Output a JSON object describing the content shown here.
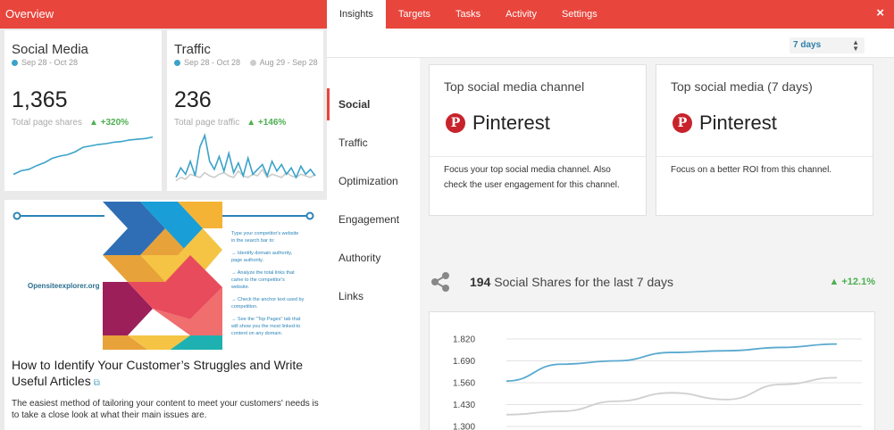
{
  "topbar": {
    "overview_title": "Overview",
    "tabs": [
      "Insights",
      "Targets",
      "Tasks",
      "Activity",
      "Settings"
    ],
    "close_glyph": "×"
  },
  "left": {
    "social": {
      "title": "Social Media",
      "range": "Sep 28 - Oct 28",
      "value": "1,365",
      "label": "Total page shares",
      "change": "▲ +320%",
      "color": "#3aa3c9",
      "spark": [
        3,
        8,
        10,
        15,
        19,
        25,
        28,
        30,
        34,
        40,
        42,
        44,
        45,
        47,
        48,
        50,
        51,
        52,
        54
      ]
    },
    "traffic": {
      "title": "Traffic",
      "range_a": "Sep 28 - Oct 28",
      "range_b": "Aug 29 - Sep 28",
      "value": "236",
      "label": "Total page traffic",
      "change": "▲ +146%",
      "color_a": "#3aa3c9",
      "color_b": "#cccccc",
      "spark_a": [
        10,
        22,
        14,
        30,
        12,
        48,
        62,
        30,
        20,
        36,
        18,
        40,
        16,
        28,
        12,
        34,
        14,
        20,
        26,
        12,
        30,
        18,
        26,
        14,
        22,
        10,
        24,
        14,
        20,
        12
      ],
      "spark_b": [
        6,
        10,
        8,
        14,
        12,
        10,
        16,
        12,
        10,
        14,
        16,
        12,
        10,
        18,
        12,
        10,
        14,
        12,
        20,
        10,
        14,
        12,
        10,
        16,
        12,
        10,
        14,
        12,
        10,
        14
      ]
    },
    "infographic": {
      "brand": "Opensiteexplorer.org",
      "tips": [
        "Type your competitor's website",
        "in the search bar to:",
        "→ Identify domain authority,",
        "page authority.",
        "→ Analyze the total links that",
        "came to the competitor's",
        "website.",
        "→ Check the anchor text used by",
        "competition.",
        "→ See the \"Top Pages\" tab that",
        "will show you the most linked-to",
        "content on any domain."
      ]
    },
    "article": {
      "title": "How to Identify Your Customer’s Struggles and Write Useful Articles",
      "link_glyph": "⧉",
      "text": "The easiest method of tailoring your content to meet your customers' needs is to take a close look at what their main issues are."
    }
  },
  "right": {
    "range_select": "7 days",
    "nav": [
      "Social",
      "Traffic",
      "Optimization",
      "Engagement",
      "Authority",
      "Links"
    ],
    "card1": {
      "heading": "Top social media channel",
      "brand": "Pinterest",
      "footer": "Focus your top social media channel. Also check the user engagement for this channel."
    },
    "card2": {
      "heading": "Top social media (7 days)",
      "brand": "Pinterest",
      "footer": "Focus on a better ROI from this channel."
    },
    "shares": {
      "count": "194",
      "text": "Social Shares for the last 7 days",
      "change": "▲ +12.1%"
    },
    "accent": "#e8453c",
    "pinterest_color": "#c8232c",
    "positive_color": "#4caf50"
  },
  "chart_data": {
    "type": "line",
    "y_ticks": [
      "1.820",
      "1.690",
      "1.560",
      "1.430",
      "1.300"
    ],
    "ylim": [
      1.3,
      1.82
    ],
    "x": [
      1,
      2,
      3,
      4,
      5,
      6,
      7
    ],
    "series": [
      {
        "color": "#5aa9cf",
        "values": [
          1.57,
          1.67,
          1.69,
          1.74,
          1.75,
          1.77,
          1.79
        ]
      },
      {
        "color": "#cfcfcf",
        "values": [
          1.37,
          1.39,
          1.45,
          1.5,
          1.46,
          1.55,
          1.59
        ]
      }
    ]
  }
}
